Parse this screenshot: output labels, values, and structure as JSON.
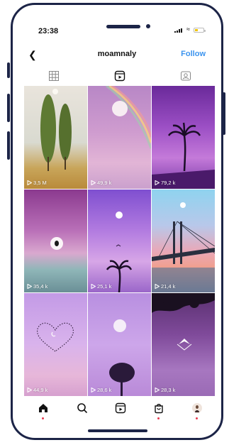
{
  "status_bar": {
    "time": "23:38"
  },
  "header": {
    "back_icon": "chevron-left-icon",
    "username": "moamnaly",
    "follow_label": "Follow",
    "follow_color": "#3a93ee"
  },
  "tabs": [
    {
      "icon": "grid-icon",
      "active": false
    },
    {
      "icon": "reels-icon",
      "active": true
    },
    {
      "icon": "tagged-icon",
      "active": false
    }
  ],
  "posts": [
    {
      "views": "3,5 M",
      "scene": "cypress trees"
    },
    {
      "views": "49,9 k",
      "scene": "rainbow moon"
    },
    {
      "views": "79,2 k",
      "scene": "palm tree"
    },
    {
      "views": "35,4 k",
      "scene": "balloon over sea"
    },
    {
      "views": "25,1 k",
      "scene": "palm and moon"
    },
    {
      "views": "21,4 k",
      "scene": "bridge"
    },
    {
      "views": "44,9 k",
      "scene": "heart of birds"
    },
    {
      "views": "28,6 k",
      "scene": "tree and moon"
    },
    {
      "views": "28,3 k",
      "scene": "leaves and bird"
    }
  ],
  "bottom_nav": [
    {
      "icon": "home-icon",
      "active": true
    },
    {
      "icon": "search-icon"
    },
    {
      "icon": "reels-icon"
    },
    {
      "icon": "shop-icon"
    },
    {
      "icon": "profile-avatar-icon"
    }
  ],
  "colors": {
    "frame": "#1c2447",
    "notification_dot": "#e53b50"
  }
}
